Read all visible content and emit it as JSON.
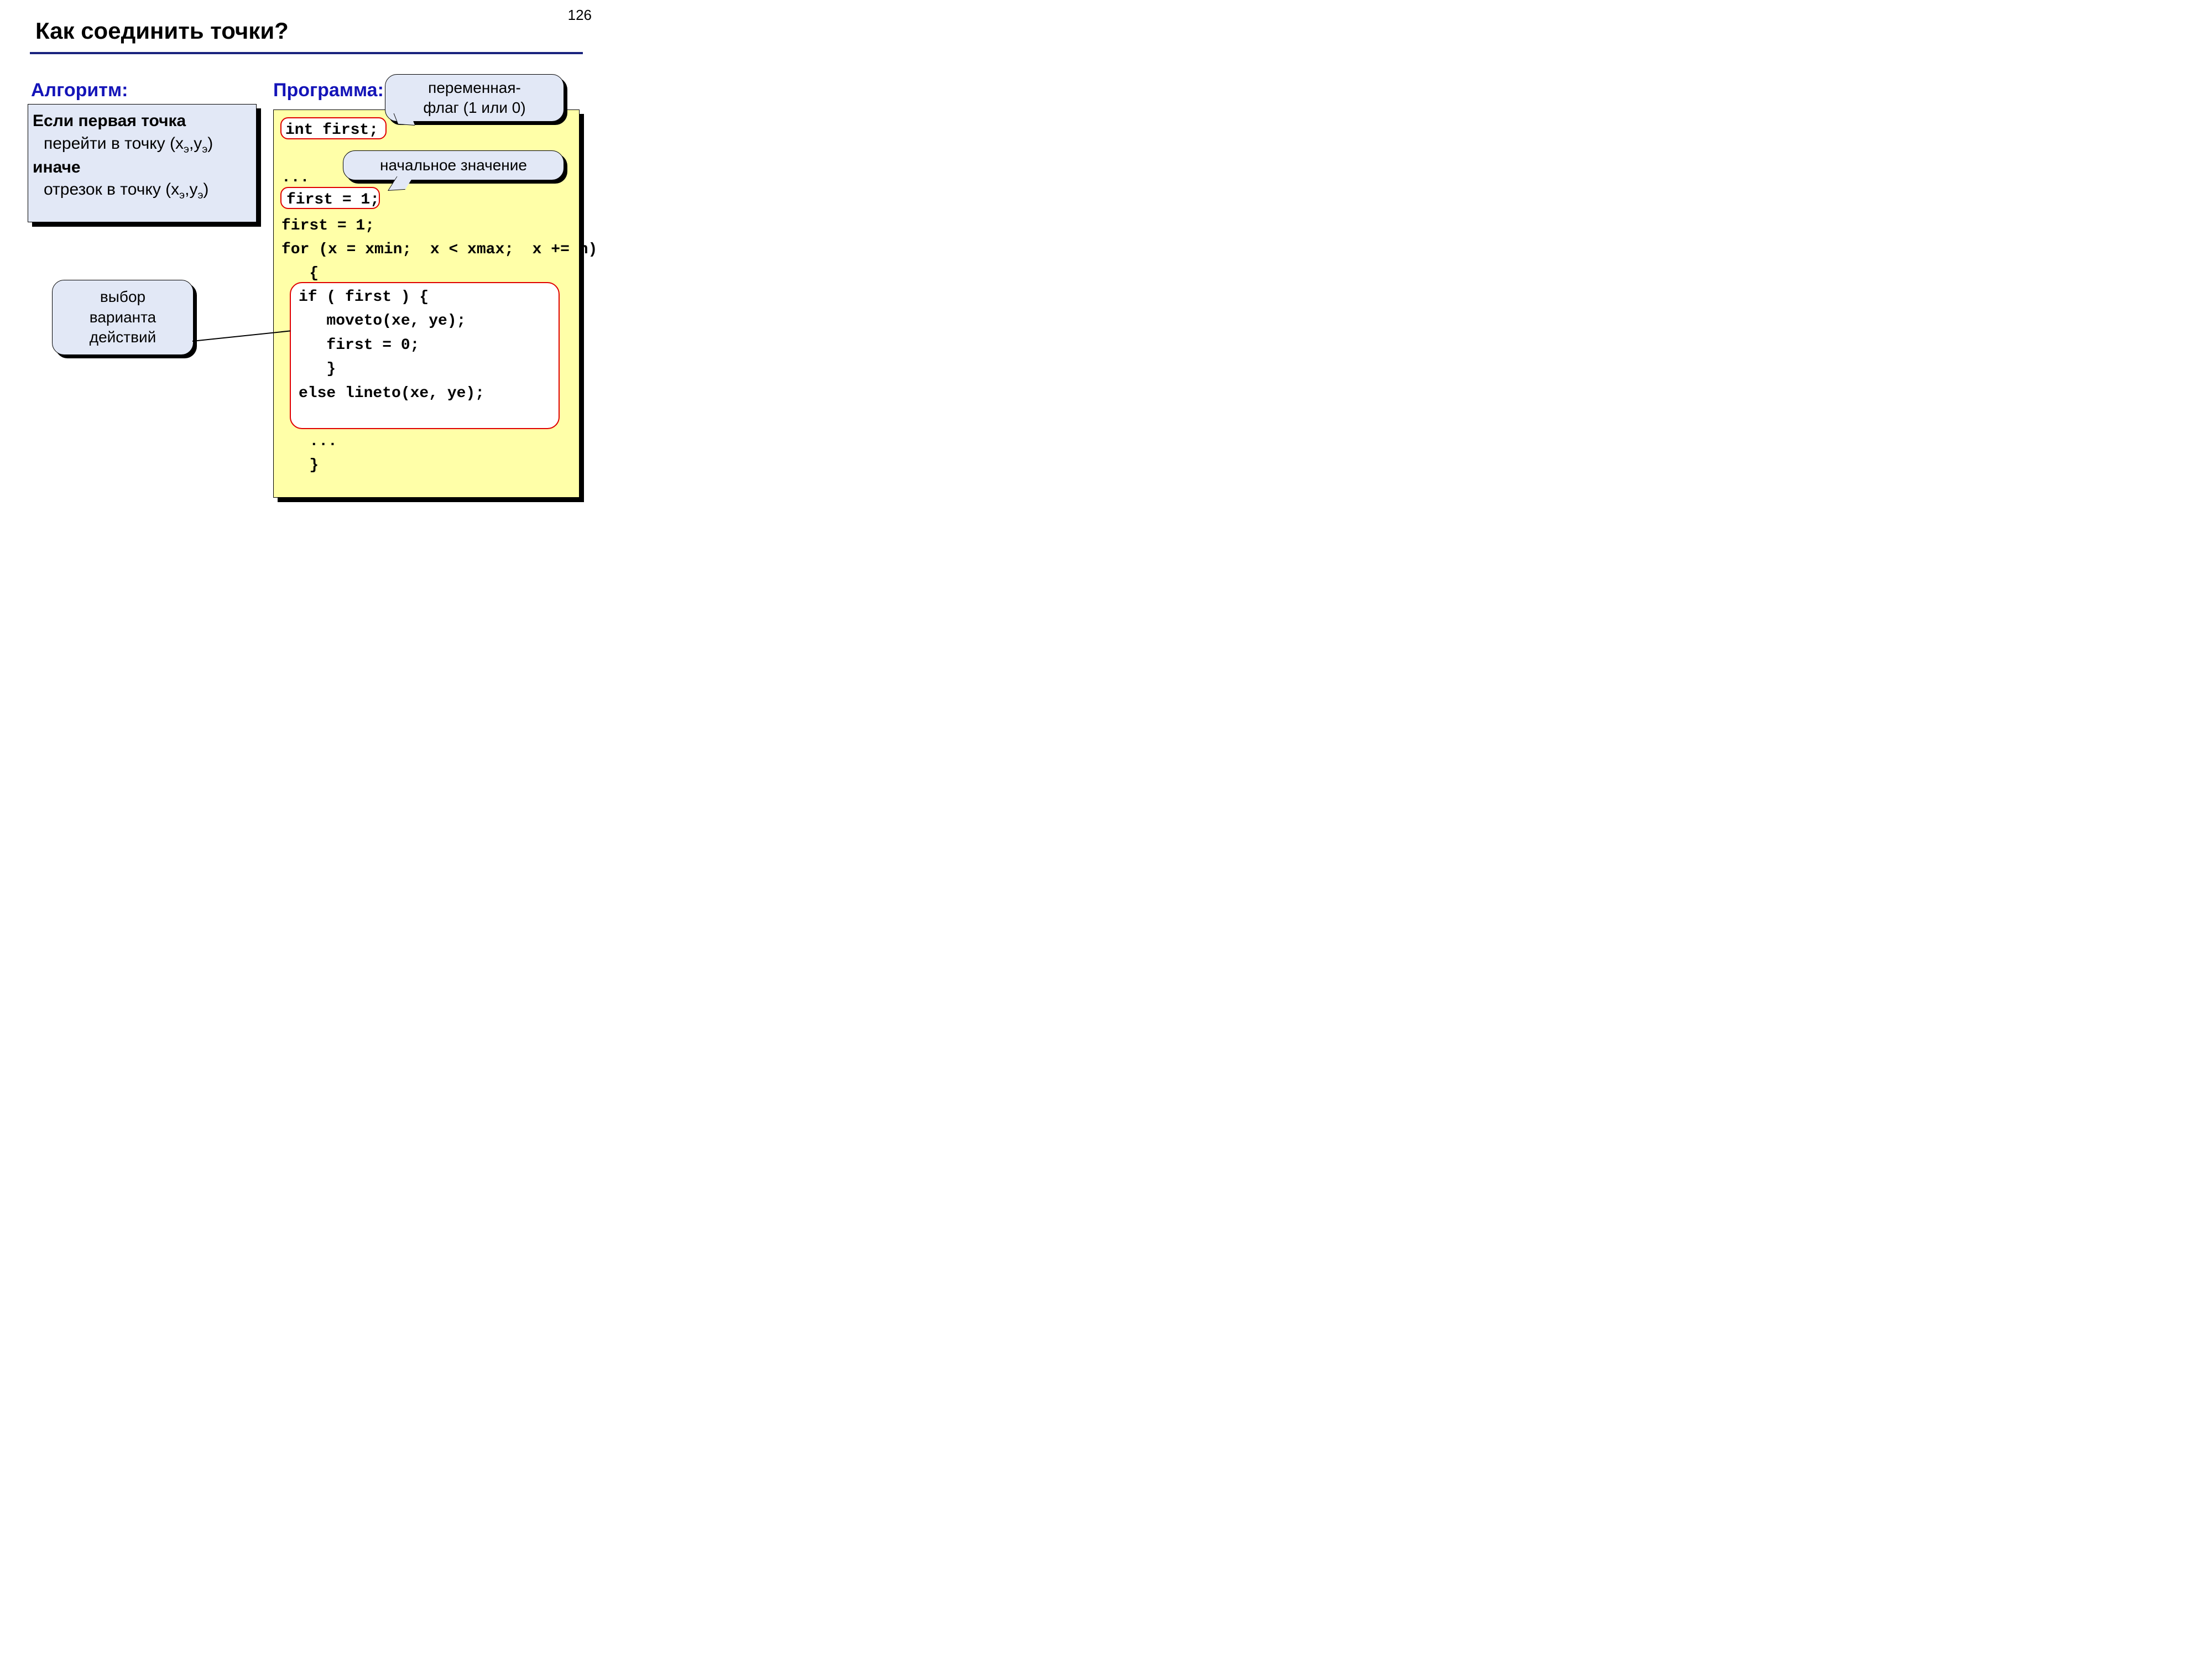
{
  "page_number": "126",
  "title": "Как соединить точки?",
  "algorithm": {
    "label": "Алгоритм:",
    "if_line": "Если первая точка",
    "moveto_prefix": "перейти в точку (x",
    "moveto_suffix": ",y",
    "moveto_close": ")",
    "else_line": "иначе",
    "lineto_prefix": "отрезок в точку (x",
    "lineto_suffix": ",y",
    "lineto_close": ")",
    "subscript": "э"
  },
  "program": {
    "label": "Программа:",
    "decl": "int first;",
    "dots1": "...",
    "init": "first = 1;",
    "for_line": "for (x = xmin;  x < xmax;  x += h)",
    "brace_open": "   {",
    "dots2": "   ...",
    "if_block_l1": "if ( first ) {",
    "if_block_l2": "   moveto(xe, ye);",
    "if_block_l3": "   first = 0;",
    "if_block_l4": "   }",
    "if_block_l5": "else lineto(xe, ye);",
    "dots3": "   ...",
    "brace_close": "   }"
  },
  "callouts": {
    "flag_var_l1": "переменная-",
    "flag_var_l2": "флаг (1 или 0)",
    "initial_value": "начальное значение",
    "choice_l1": "выбор",
    "choice_l2": "варианта",
    "choice_l3": "действий"
  }
}
